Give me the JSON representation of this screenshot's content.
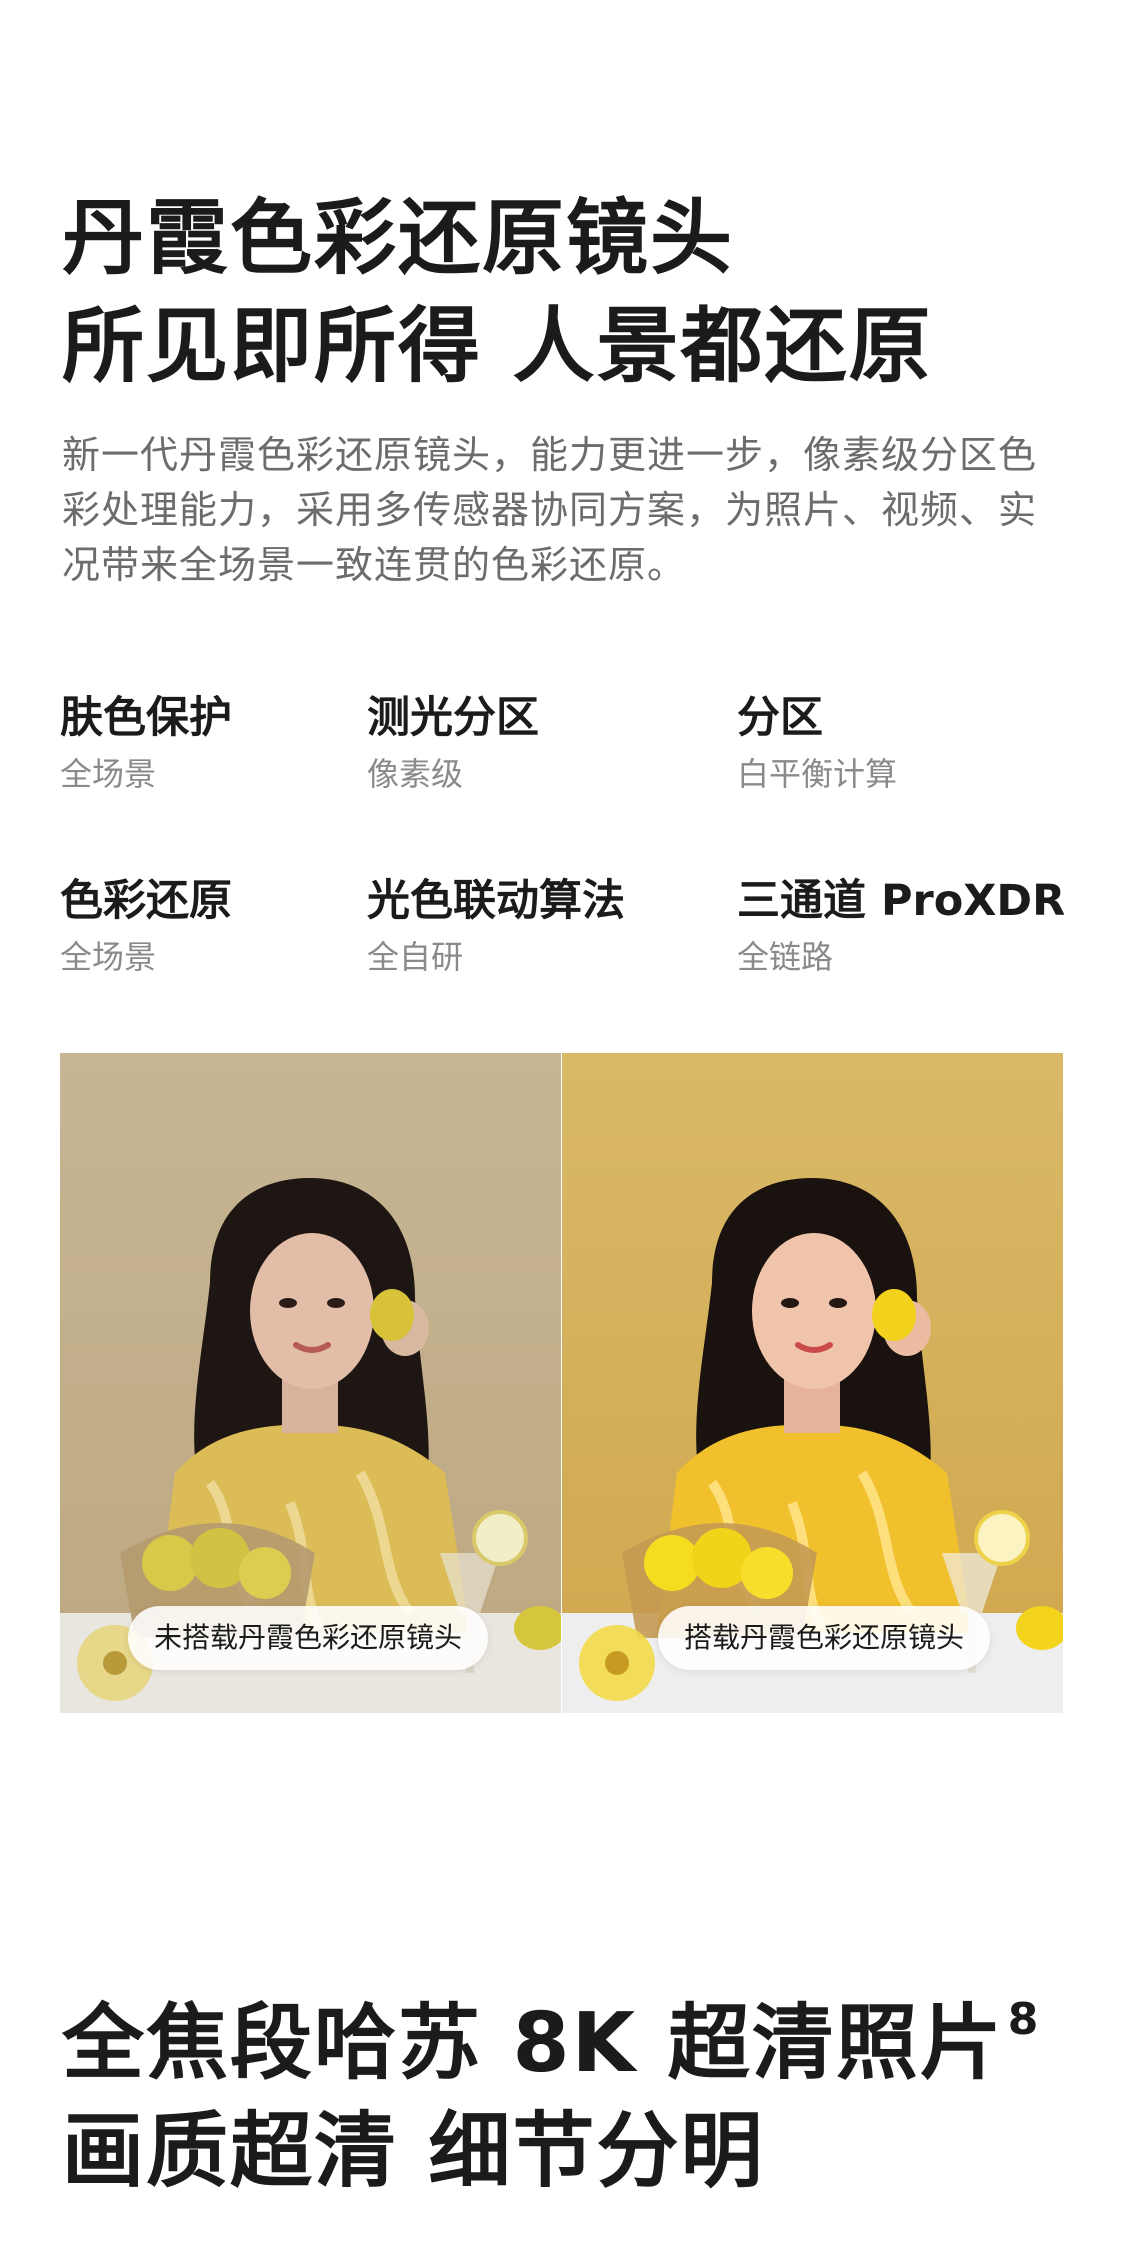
{
  "hero": {
    "title_line1": "丹霞色彩还原镜头",
    "title_line2": "所见即所得 人景都还原",
    "desc_line1": "新一代丹霞色彩还原镜头，能力更进一步，像素级分区色",
    "desc_line2": "彩处理能力，采用多传感器协同方案，为照片、视频、实",
    "desc_line3": "况带来全场景一致连贯的色彩还原。"
  },
  "features": [
    {
      "title": "肤色保护",
      "sub": "全场景"
    },
    {
      "title": "测光分区",
      "sub": "像素级"
    },
    {
      "title": "分区",
      "sub": "白平衡计算"
    },
    {
      "title": "色彩还原",
      "sub": "全场景"
    },
    {
      "title": "光色联动算法",
      "sub": "全自研"
    },
    {
      "title": "三通道 ProXDR",
      "sub": "全链路"
    }
  ],
  "comparison": {
    "left_label": "未搭载丹霞色彩还原镜头",
    "right_label": "搭载丹霞色彩还原镜头",
    "left_bg": "#c9b48e",
    "right_bg": "#d6b25e"
  },
  "bottom": {
    "title_line1": "全焦段哈苏 8K 超清照片",
    "title_sup": "8",
    "title_line2": "画质超清 细节分明"
  }
}
